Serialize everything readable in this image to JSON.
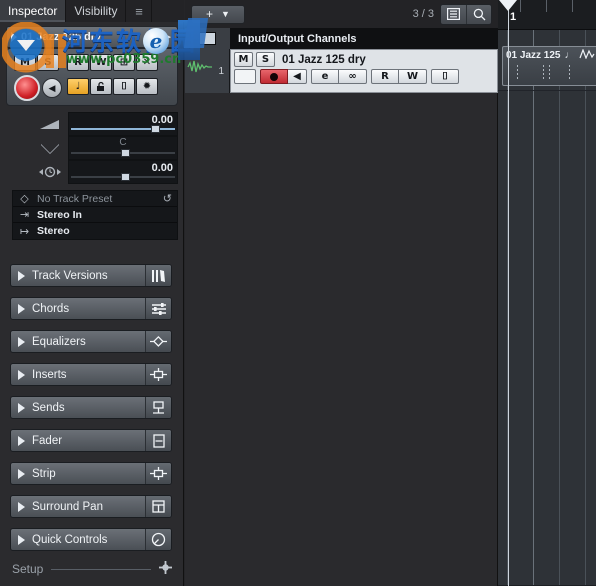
{
  "inspector": {
    "tabs": [
      {
        "label": "Inspector",
        "active": true
      },
      {
        "label": "Visibility",
        "active": false
      },
      {
        "label": "≡",
        "active": false
      }
    ],
    "track_name": "01 Jazz 125 dry",
    "expand_arrow": "►",
    "buttons": {
      "mute": "M",
      "solo": "S",
      "read": "R",
      "write": "W",
      "edit_channel": "⊞",
      "bypass_inserts": "✕",
      "record_enable": "record-dot",
      "monitor": "◀",
      "musical_mode": "♩",
      "lock": "lock-glyph",
      "lanes": "⌷",
      "freeze": "✹"
    },
    "faders": [
      {
        "icon": "volume-ramp",
        "value": "0.00",
        "center_label": ""
      },
      {
        "icon": "pan-v",
        "value": "",
        "center_label": "C"
      },
      {
        "icon": "delay-clock",
        "value": "0.00",
        "center_label": ""
      }
    ],
    "preset_rows": [
      {
        "icon": "◇",
        "label": "No Track Preset",
        "dim": true,
        "right": "↺"
      },
      {
        "icon": "⇥",
        "label": "Stereo In",
        "dim": false,
        "right": ""
      },
      {
        "icon": "↦",
        "label": "Stereo",
        "dim": false,
        "right": ""
      }
    ],
    "sections": [
      {
        "label": "Track Versions",
        "icon": "versions-icon"
      },
      {
        "label": "Chords",
        "icon": "sliders-icon"
      },
      {
        "label": "Equalizers",
        "icon": "eq-diamond-icon"
      },
      {
        "label": "Inserts",
        "icon": "insert-icon"
      },
      {
        "label": "Sends",
        "icon": "send-icon"
      },
      {
        "label": "Fader",
        "icon": "fader-icon"
      },
      {
        "label": "Strip",
        "icon": "strip-icon"
      },
      {
        "label": "Surround Pan",
        "icon": "surround-icon"
      },
      {
        "label": "Quick Controls",
        "icon": "quick-knob-icon"
      }
    ],
    "setup": {
      "label": "Setup",
      "icon": "gear-icon"
    }
  },
  "mixer": {
    "add_button": {
      "plus": "+",
      "chevron": "▼"
    },
    "channel_count": "3 / 3",
    "tool_buttons": [
      {
        "name": "list-view-icon",
        "glyph": "☰"
      },
      {
        "name": "search-icon",
        "glyph": "⌕"
      }
    ],
    "group_header": "Input/Output Channels",
    "channel": {
      "number": "1",
      "name": "01 Jazz 125 dry",
      "mute": "M",
      "solo": "S",
      "record": "record-dot",
      "monitor": "◀",
      "edit": "e",
      "link": "∞",
      "read": "R",
      "write": "W",
      "lanes": "⌷"
    }
  },
  "arrange": {
    "playhead_position": "1",
    "clip": {
      "name": "01 Jazz 125",
      "note_icon": "♩",
      "wave_icon": "waveform-icon"
    }
  },
  "watermark": {
    "site_name": "河东软件园",
    "url": "www.pc0359.cn"
  }
}
